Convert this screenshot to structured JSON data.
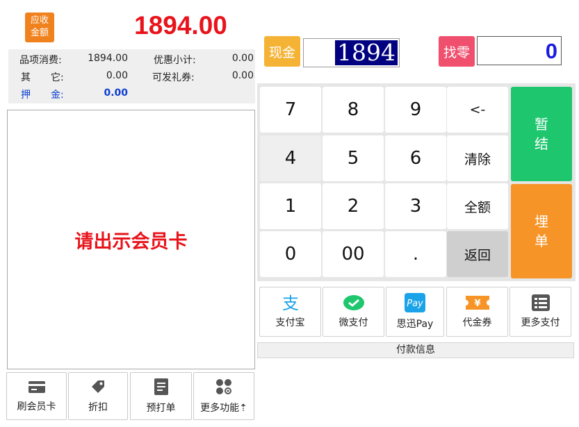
{
  "due": {
    "badge_line1": "应收",
    "badge_line2": "金额",
    "amount": "1894.00"
  },
  "summary": {
    "item_label": "品项消费:",
    "item_value": "1894.00",
    "discount_label": "优惠小计:",
    "discount_value": "0.00",
    "other_label_1": "其",
    "other_label_2": "它:",
    "other_value": "0.00",
    "gift_label": "可发礼券:",
    "gift_value": "0.00",
    "deposit_label_1": "押",
    "deposit_label_2": "金:",
    "deposit_value": "0.00"
  },
  "member": {
    "prompt": "请出示会员卡"
  },
  "bottom_buttons": {
    "swipe": "刷会员卡",
    "discount": "折扣",
    "preprint": "预打单",
    "more": "更多功能⇡"
  },
  "cash": {
    "label": "现金",
    "value": "1894"
  },
  "change": {
    "label": "找零",
    "value": "0"
  },
  "keypad": {
    "k7": "7",
    "k8": "8",
    "k9": "9",
    "back": "<-",
    "k4": "4",
    "k5": "5",
    "k6": "6",
    "clear": "清除",
    "k1": "1",
    "k2": "2",
    "k3": "3",
    "full": "全额",
    "k0": "0",
    "k00": "00",
    "dot": ".",
    "ret": "返回",
    "suspend_1": "暂",
    "suspend_2": "结",
    "hold_1": "埋",
    "hold_2": "单"
  },
  "payments": {
    "alipay": "支付宝",
    "wechat": "微支付",
    "sixun": "思迅Pay",
    "voucher": "代金券",
    "more": "更多支付"
  },
  "icons": {
    "alipay": "alipay-icon",
    "wechat": "wechat-icon",
    "sixun": "pay-icon",
    "voucher": "voucher-icon",
    "more": "more-payment-icon"
  },
  "pay_info": {
    "label": "付款信息"
  },
  "colors": {
    "accent_red": "#e8141c",
    "cash_orange": "#f5b335",
    "change_pink": "#f0506e",
    "suspend_green": "#1ec66e",
    "hold_orange": "#f79428"
  }
}
